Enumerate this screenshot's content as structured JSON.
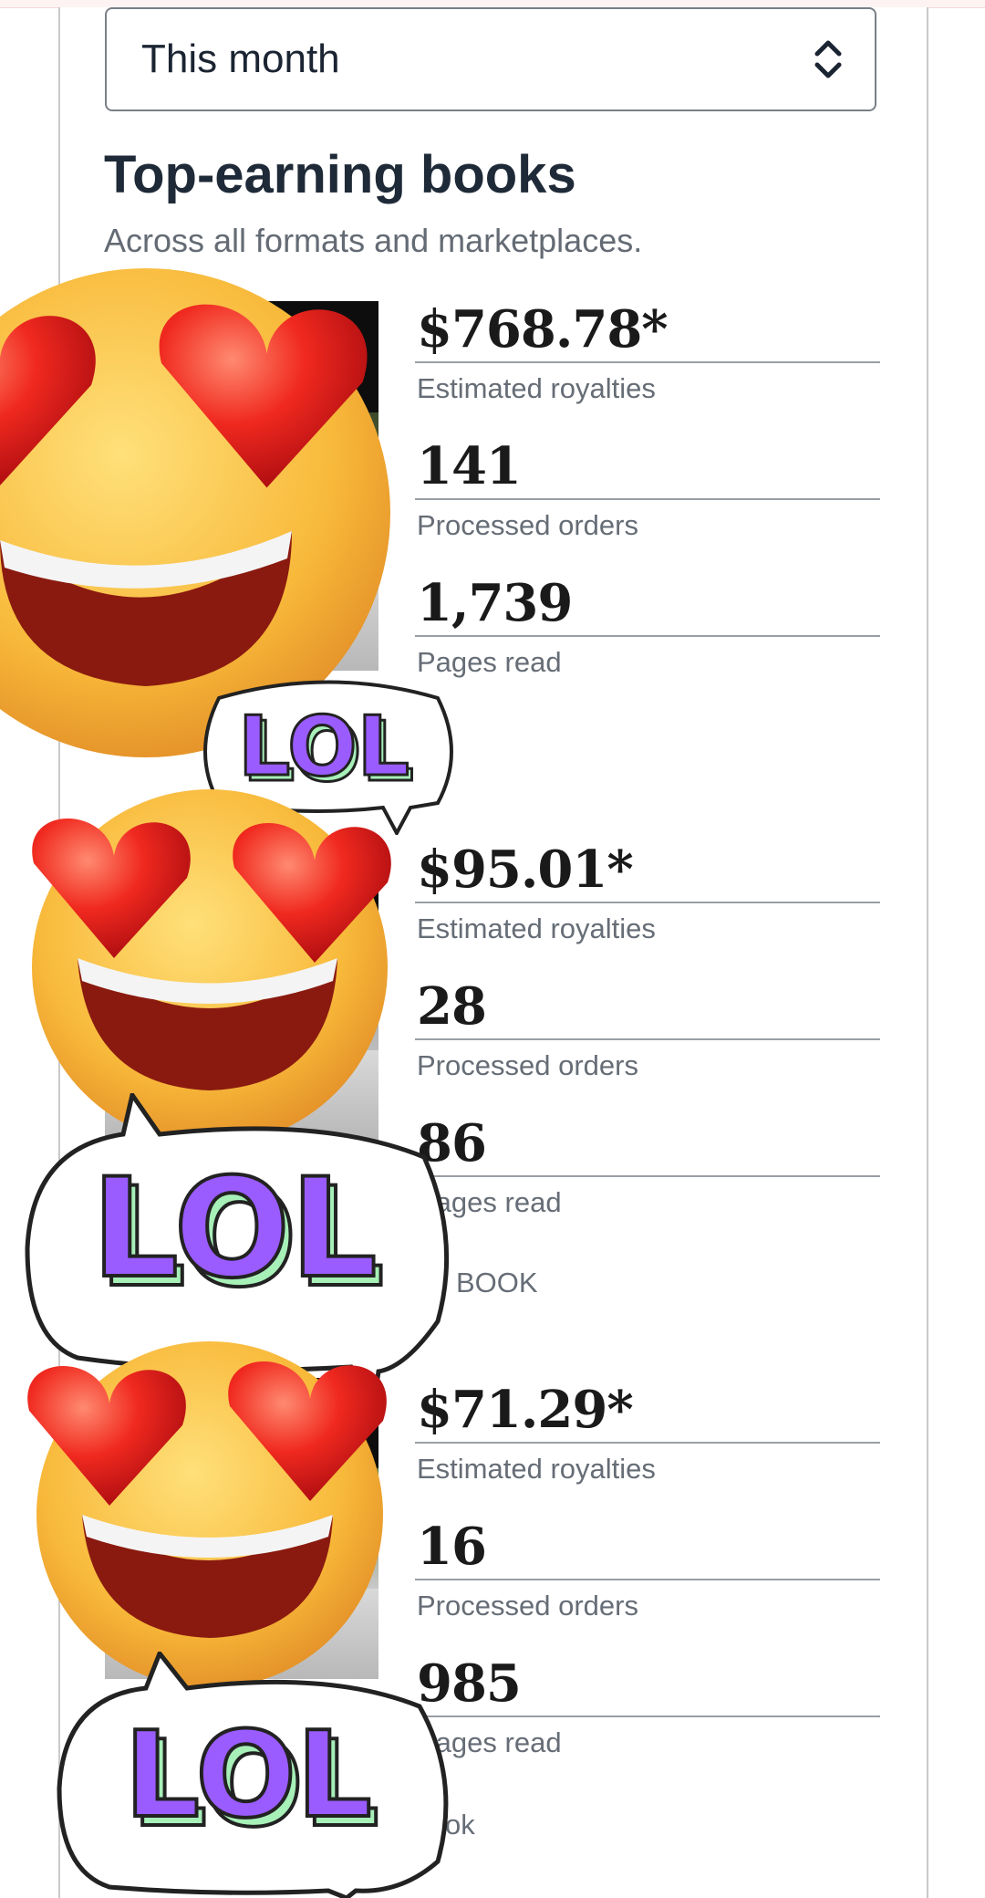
{
  "filter": {
    "selected": "This month"
  },
  "section": {
    "title": "Top-earning books",
    "subtitle": "Across all formats and marketplaces."
  },
  "books": [
    {
      "royalties": "$768.78*",
      "royalties_label": "Estimated royalties",
      "orders": "141",
      "orders_label": "Processed orders",
      "pages": "1,739",
      "pages_label": "Pages read",
      "format": ""
    },
    {
      "royalties": "$95.01*",
      "royalties_label": "Estimated royalties",
      "orders": "28",
      "orders_label": "Processed orders",
      "pages": "86",
      "pages_label": "Pages read",
      "format": "BOOK"
    },
    {
      "royalties": "$71.29*",
      "royalties_label": "Estimated royalties",
      "orders": "16",
      "orders_label": "Processed orders",
      "pages": "985",
      "pages_label": "Pages read",
      "format": "ok"
    }
  ],
  "stickers": {
    "text": "LOL",
    "emoji": "heart-eyes-face-icon"
  },
  "colors": {
    "title": "#1f2a38",
    "muted": "#666d76",
    "rule": "#9a9ea4",
    "lol_purple": "#9a5cff",
    "lol_green": "#a7f0b8"
  }
}
